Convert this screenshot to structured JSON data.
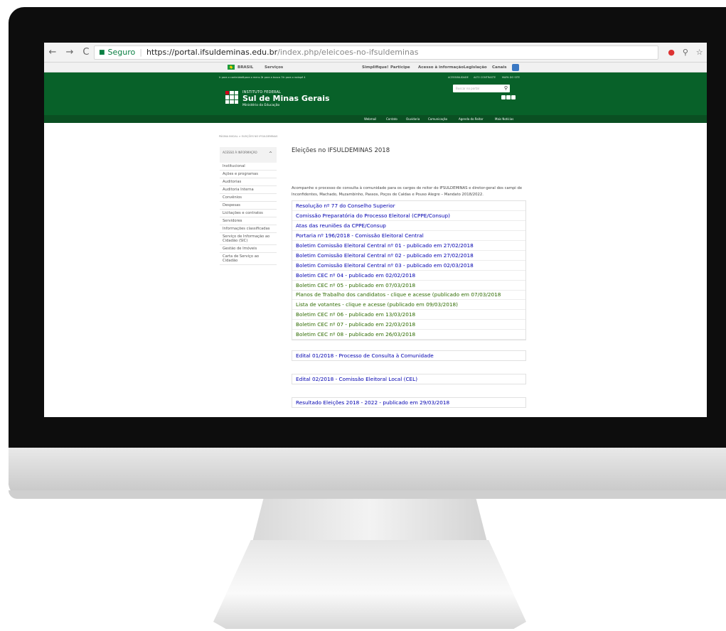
{
  "browser": {
    "secure_label": "Seguro",
    "url_host": "https://portal.ifsuldeminas.edu.br",
    "url_path": "/index.php/eleicoes-no-ifsuldeminas",
    "back": "←",
    "forward": "→",
    "reload": "C"
  },
  "govbar": {
    "brasil": "BRASIL",
    "servicos": "Serviços",
    "simplifique": "Simplifique!",
    "participe": "Participe",
    "acesso": "Acesso à informação",
    "legislacao": "Legislação",
    "canais": "Canais"
  },
  "header": {
    "skip_content": "Ir para o conteúdo 1",
    "skip_menu": "Ir para o menu 2",
    "skip_search": "Ir para a busca 3",
    "skip_footer": "Ir para o rodapé 4",
    "acessibilidade": "ACESSIBILIDADE",
    "alto_contraste": "ALTO CONTRASTE",
    "mapa_site": "MAPA DO SITE",
    "institute": "INSTITUTO FEDERAL",
    "name": "Sul de Minas Gerais",
    "ministry": "Ministério da Educação",
    "search_placeholder": "Buscar no portal"
  },
  "menu": [
    "Webmail",
    "Contato",
    "Ouvidoria",
    "Comunicação",
    "Agenda do Reitor",
    "Mais Notícias"
  ],
  "breadcrumb": "PÁGINA INICIAL > ELEIÇÕES NO IFSULDEMINAS",
  "sidebar": {
    "heading": "ACESSO À INFORMAÇÃO",
    "items": [
      "Institucional",
      "Ações e programas",
      "Auditorias",
      "Auditoria Interna",
      "Convênios",
      "Despesas",
      "Licitações e contratos",
      "Servidores",
      "Informações classificadas",
      "Serviço de Informação ao Cidadão (SIC)",
      "Gestão de Imóveis",
      "Carta de Serviço ao Cidadão"
    ]
  },
  "main": {
    "title": "Eleições no IFSULDEMINAS 2018",
    "intro": "Acompanhe o processo de consulta à comunidade para os cargos de reitor do IFSULDEMINAS e diretor-geral dos campi de Inconfidentes, Machado, Muzambinho, Passos, Poços de Caldas e Pouso Alegre – Mandato 2018/2022.",
    "links": [
      {
        "text": "Resolução nº 77 do Conselho Superior",
        "color": "blue"
      },
      {
        "text": "Comissão Preparatória do Processo Eleitoral (CPPE/Consup)",
        "color": "blue"
      },
      {
        "text": "Atas das reuniões da CPPE/Consup",
        "color": "blue"
      },
      {
        "text": "Portaria nº 196/2018 - Comissão Eleitoral Central",
        "color": "blue"
      },
      {
        "text": "Boletim Comissão Eleitoral Central nº 01 - publicado em 27/02/2018",
        "color": "blue"
      },
      {
        "text": "Boletim Comissão Eleitoral Central nº 02 - publicado em 27/02/2018",
        "color": "blue"
      },
      {
        "text": "Boletim Comissão Eleitoral Central nº 03 - publicado em 02/03/2018",
        "color": "blue"
      },
      {
        "text": "Boletim CEC nº 04 - publicado em 02/02/2018",
        "color": "blue"
      },
      {
        "text": "Boletim CEC nº 05 - publicado em 07/03/2018",
        "color": "green"
      },
      {
        "text": "Planos de Trabalho dos candidatos - clique e acesse (publicado em 07/03/2018",
        "color": "green"
      },
      {
        "text": "Lista de votantes - clique e acesse (publicado em 09/03/2018)",
        "color": "green"
      },
      {
        "text": "Boletim CEC nº 06 - publicado em 13/03/2018",
        "color": "green"
      },
      {
        "text": "Boletim CEC nº 07 - publicado em 22/03/2018",
        "color": "green"
      },
      {
        "text": "Boletim CEC nº 08 - publicado em 26/03/2018",
        "color": "green"
      }
    ],
    "edital1": "Edital 01/2018 - Processo de Consulta à Comunidade",
    "edital2": "Edital 02/2018 - Comissão Eleitoral Local (CEL)",
    "resultado": "Resultado Eleições 2018 - 2022 - publicado em 29/03/2018"
  },
  "colors": {
    "header_green": "#086129",
    "menu_green": "#0a4f22",
    "link_blue": "#0000b0",
    "link_green": "#2e6b00"
  }
}
